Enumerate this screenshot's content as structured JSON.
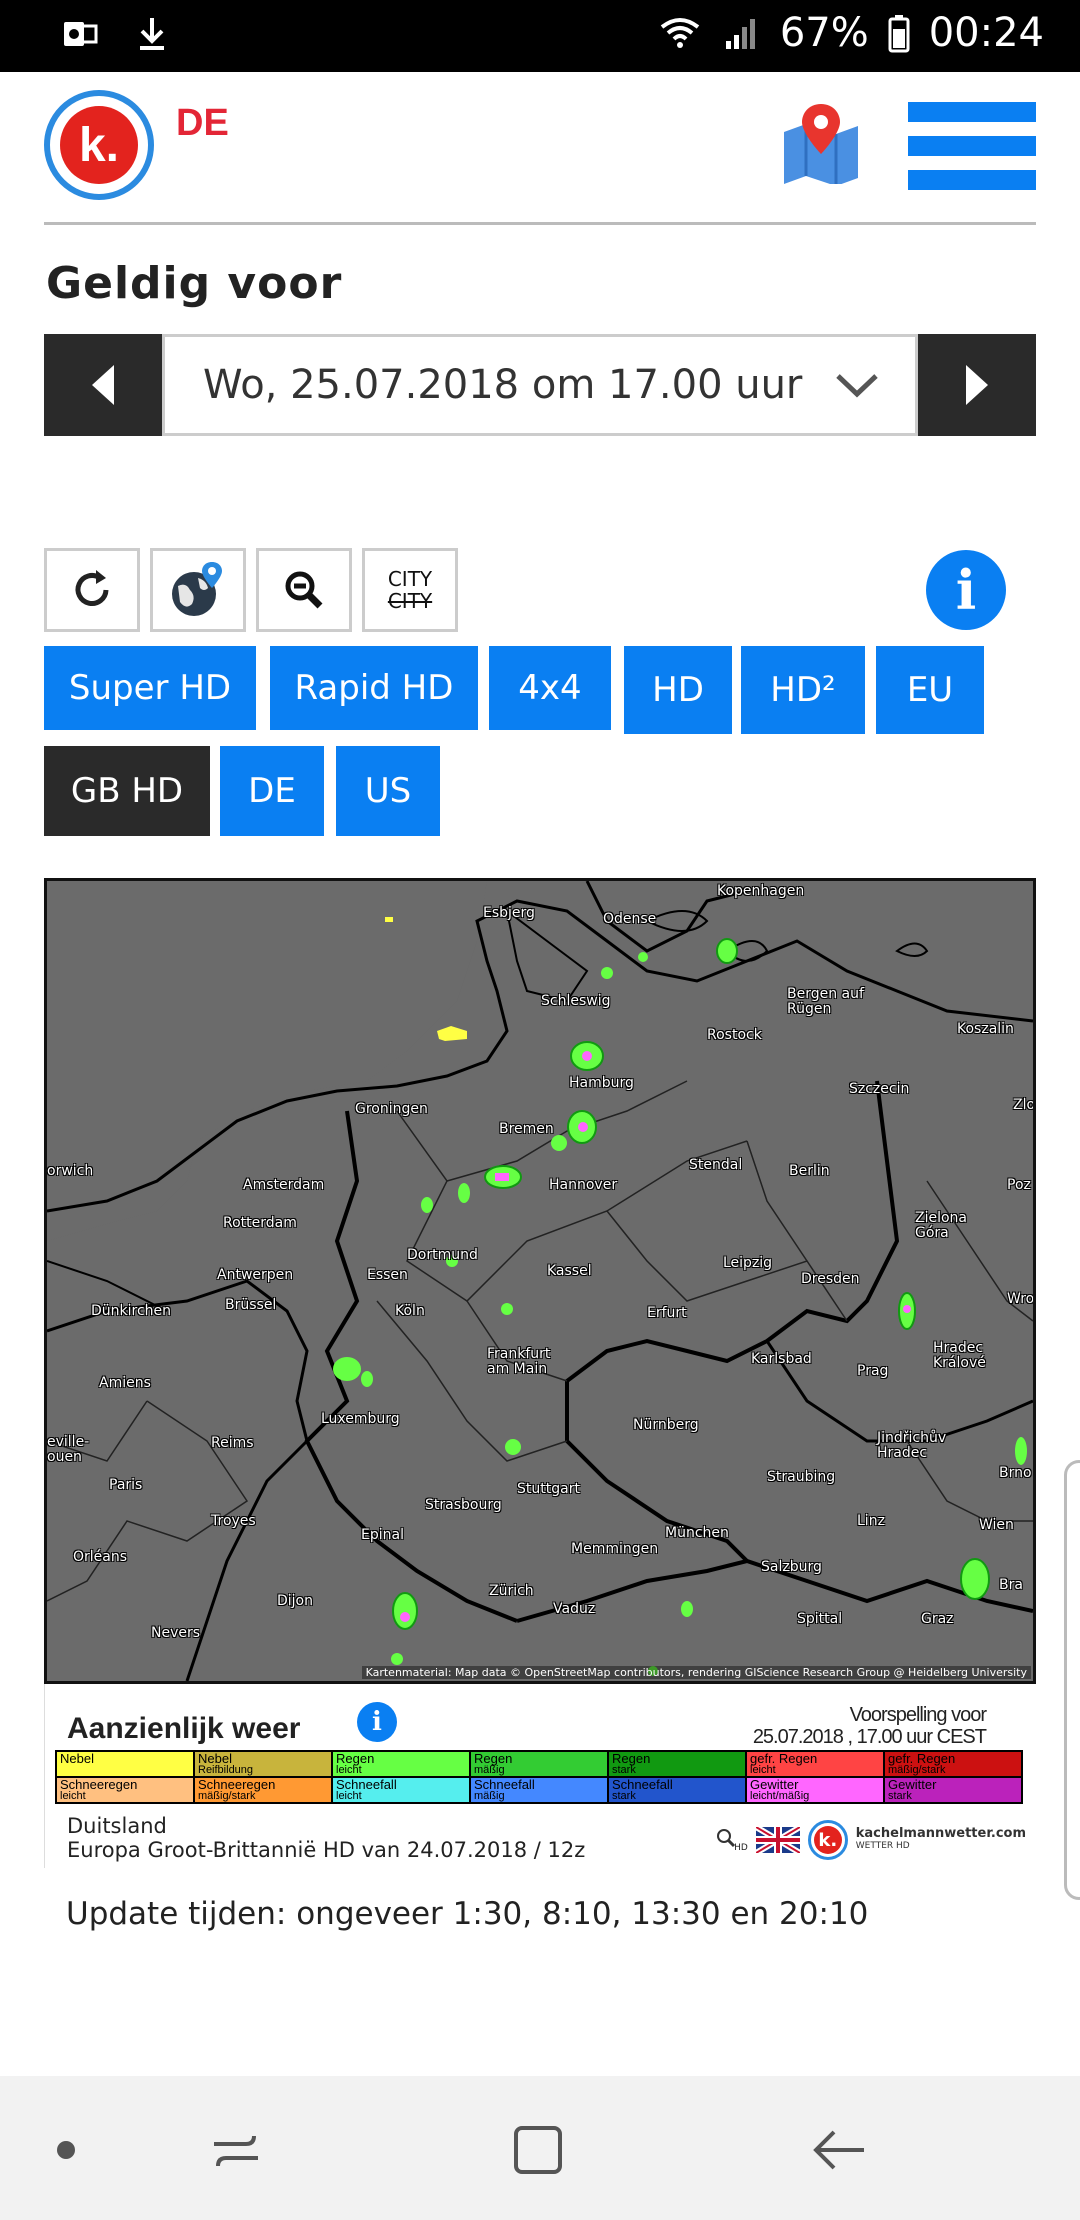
{
  "status_bar": {
    "battery": "67%",
    "time": "00:24"
  },
  "header": {
    "logo_letter": "k.",
    "region": "DE"
  },
  "validity": {
    "title": "Geldig voor",
    "selected_datetime": "Wo, 25.07.2018 om 17.00 uur"
  },
  "tools": {
    "city_label": "CITY",
    "city_label_off": "CITY",
    "info_glyph": "i"
  },
  "models": [
    {
      "label": "Super HD",
      "active": false
    },
    {
      "label": "Rapid HD",
      "active": false
    },
    {
      "label": "4x4",
      "active": false
    },
    {
      "label": "HD",
      "active": false
    },
    {
      "label": "HD²",
      "active": false
    },
    {
      "label": "EU",
      "active": false
    },
    {
      "label": "GB HD",
      "active": true
    },
    {
      "label": "DE",
      "active": false
    },
    {
      "label": "US",
      "active": false
    }
  ],
  "map": {
    "cities": [
      "Kopenhagen",
      "Esbjerg",
      "Odense",
      "Schleswig",
      "Bergen auf Rügen",
      "Rostock",
      "Koszalin",
      "Hamburg",
      "Szczecin",
      "Groningen",
      "Bremen",
      "Amsterdam",
      "Hannover",
      "Stendal",
      "Berlin",
      "Rotterdam",
      "Zielona Góra",
      "Dortmund",
      "Antwerpen",
      "Essen",
      "Kassel",
      "Leipzig",
      "Dresden",
      "Dünkirchen",
      "Brüssel",
      "Köln",
      "Erfurt",
      "Frankfurt am Main",
      "Karlsbad",
      "Hradec Králové",
      "Prag",
      "Amiens",
      "Luxemburg",
      "Nürnberg",
      "Reims",
      "Jindřichův Hradec",
      "Paris",
      "Stuttgart",
      "Straubing",
      "Strasbourg",
      "Troyes",
      "Linz",
      "Epinal",
      "Memmingen",
      "München",
      "Wien",
      "Orléans",
      "Salzburg",
      "Dijon",
      "Zürich",
      "Vaduz",
      "Spittal",
      "Graz",
      "Nevers",
      "Zlo",
      "Poz",
      "Wro",
      "Brno",
      "Bra",
      "orwich",
      "eville-\nouen"
    ],
    "attribution": "Kartenmaterial: Map data © OpenStreetMap contributors, rendering GIScience Research Group @ Heidelberg University"
  },
  "legend": {
    "title": "Aanzienlijk weer",
    "forecast_label": "Voorspelling voor",
    "forecast_time": "25.07.2018 , 17.00 uur CEST",
    "row1": [
      {
        "label": "Nebel",
        "sub": "",
        "color": "#ffff44"
      },
      {
        "label": "Nebel",
        "sub": "Reifbildung",
        "color": "#c8b43c"
      },
      {
        "label": "Regen",
        "sub": "leicht",
        "color": "#66ff44"
      },
      {
        "label": "Regen",
        "sub": "mäßig",
        "color": "#33cc33"
      },
      {
        "label": "Regen",
        "sub": "stark",
        "color": "#119911"
      },
      {
        "label": "gefr. Regen",
        "sub": "leicht",
        "color": "#ff4444"
      },
      {
        "label": "gefr. Regen",
        "sub": "mäßig/stark",
        "color": "#cc1111"
      }
    ],
    "row2": [
      {
        "label": "Schneeregen",
        "sub": "leicht",
        "color": "#ffc080"
      },
      {
        "label": "Schneeregen",
        "sub": "mäßig/stark",
        "color": "#ff9933"
      },
      {
        "label": "Schneefall",
        "sub": "leicht",
        "color": "#55eeee"
      },
      {
        "label": "Schneefall",
        "sub": "mäßig",
        "color": "#4488ff"
      },
      {
        "label": "Schneefall",
        "sub": "stark",
        "color": "#2255cc"
      },
      {
        "label": "Gewitter",
        "sub": "leicht/mäßig",
        "color": "#ff66ff"
      },
      {
        "label": "Gewitter",
        "sub": "stark",
        "color": "#bb22bb"
      }
    ],
    "region_line1": "Duitsland",
    "region_line2": "Europa Groot-Brittannië HD van 24.07.2018 / 12z",
    "brand": "kachelmannwetter.com",
    "brand_sub": "WETTER HD",
    "hd_label": "HD"
  },
  "update_times": "Update tijden: ongeveer 1:30, 8:10, 13:30 en 20:10",
  "colors": {
    "accent": "#0a7ff2",
    "dark_button": "#2a2a2a",
    "map_bg": "#6b6b6b"
  }
}
